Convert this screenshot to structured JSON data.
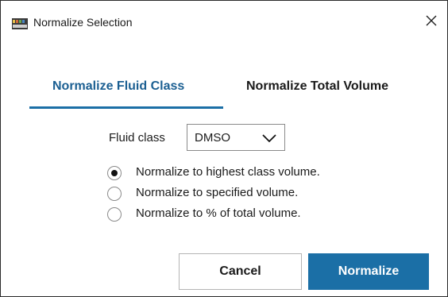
{
  "window": {
    "title": "Normalize Selection",
    "app_icon": "palette-icon",
    "close_icon": "close-icon"
  },
  "tabs": [
    {
      "label": "Normalize Fluid Class",
      "active": true
    },
    {
      "label": "Normalize Total Volume",
      "active": false
    }
  ],
  "fluid_class": {
    "label": "Fluid class",
    "selected": "DMSO",
    "icon": "chevron-down-icon"
  },
  "options": [
    {
      "label": "Normalize to highest class volume.",
      "checked": true
    },
    {
      "label": "Normalize to specified volume.",
      "checked": false
    },
    {
      "label": "Normalize to % of total volume.",
      "checked": false
    }
  ],
  "buttons": {
    "cancel": "Cancel",
    "normalize": "Normalize"
  },
  "colors": {
    "accent": "#1b6fa6",
    "active_tab_text": "#1b5f92"
  }
}
